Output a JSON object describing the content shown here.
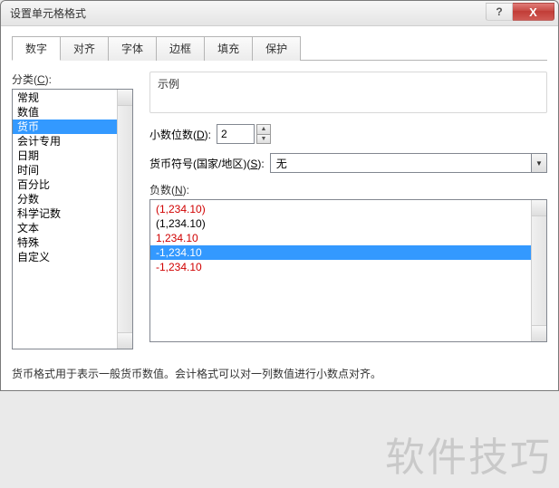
{
  "window": {
    "title": "设置单元格格式"
  },
  "titlebar": {
    "help": "?",
    "close": "X"
  },
  "tabs": [
    "数字",
    "对齐",
    "字体",
    "边框",
    "填充",
    "保护"
  ],
  "activeTab": 0,
  "category": {
    "label_pre": "分类(",
    "label_key": "C",
    "label_post": "):",
    "items": [
      "常规",
      "数值",
      "货币",
      "会计专用",
      "日期",
      "时间",
      "百分比",
      "分数",
      "科学记数",
      "文本",
      "特殊",
      "自定义"
    ],
    "selectedIndex": 2
  },
  "sample": {
    "label": "示例",
    "value": ""
  },
  "decimals": {
    "label_pre": "小数位数(",
    "label_key": "D",
    "label_post": "):",
    "value": "2"
  },
  "symbol": {
    "label_pre": "货币符号(国家/地区)(",
    "label_key": "S",
    "label_post": "):",
    "value": "无"
  },
  "negative": {
    "label_pre": "负数(",
    "label_key": "N",
    "label_post": "):",
    "items": [
      {
        "text": "(1,234.10)",
        "color": "#d00000"
      },
      {
        "text": "(1,234.10)",
        "color": "#000000"
      },
      {
        "text": "1,234.10",
        "color": "#d00000"
      },
      {
        "text": "-1,234.10",
        "color": "#000000"
      },
      {
        "text": "-1,234.10",
        "color": "#d00000"
      }
    ],
    "selectedIndex": 3
  },
  "description": "货币格式用于表示一般货币数值。会计格式可以对一列数值进行小数点对齐。",
  "watermark": "软件技巧"
}
